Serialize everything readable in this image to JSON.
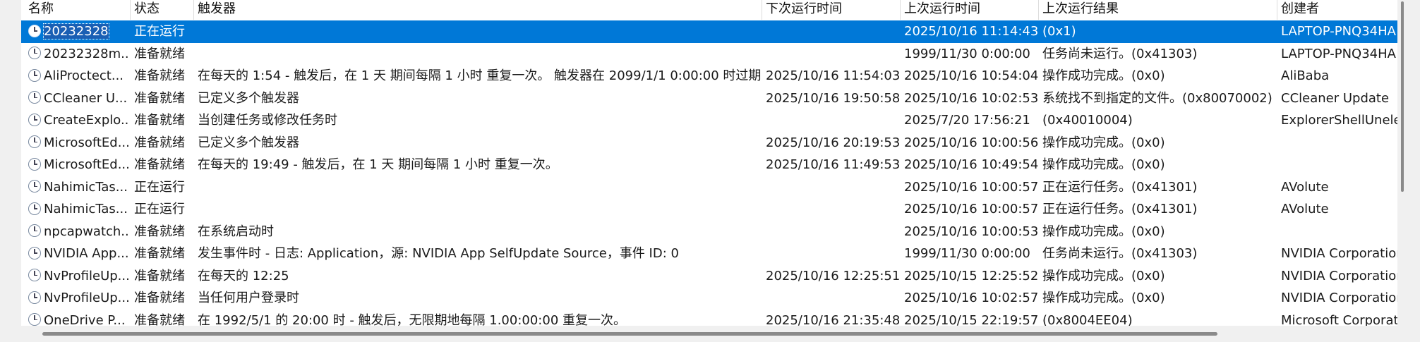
{
  "columns": {
    "name": "名称",
    "status": "状态",
    "trigger": "触发器",
    "next_run": "下次运行时间",
    "last_run": "上次运行时间",
    "last_result": "上次运行结果",
    "author": "创建者"
  },
  "rows": [
    {
      "name": "20232328",
      "status": "正在运行",
      "trigger": "",
      "next_run": "",
      "last_run": "2025/10/16 11:14:43",
      "last_result": "(0x1)",
      "author": "LAPTOP-PNQ34HA"
    },
    {
      "name": "20232328m...",
      "status": "准备就绪",
      "trigger": "",
      "next_run": "",
      "last_run": "1999/11/30 0:00:00",
      "last_result": "任务尚未运行。(0x41303)",
      "author": "LAPTOP-PNQ34HA"
    },
    {
      "name": "AliProctect...",
      "status": "准备就绪",
      "trigger": "在每天的 1:54 - 触发后，在 1 天 期间每隔 1 小时 重复一次。 触发器在 2099/1/1 0:00:00 时过期。",
      "next_run": "2025/10/16 11:54:03",
      "last_run": "2025/10/16 10:54:04",
      "last_result": "操作成功完成。(0x0)",
      "author": "AliBaba"
    },
    {
      "name": "CCleaner U...",
      "status": "准备就绪",
      "trigger": "已定义多个触发器",
      "next_run": "2025/10/16 19:50:58",
      "last_run": "2025/10/16 10:02:53",
      "last_result": "系统找不到指定的文件。(0x80070002)",
      "author": "CCleaner Update"
    },
    {
      "name": "CreateExplo...",
      "status": "准备就绪",
      "trigger": "当创建任务或修改任务时",
      "next_run": "",
      "last_run": "2025/7/20 17:56:21",
      "last_result": "(0x40010004)",
      "author": "ExplorerShellUnelev"
    },
    {
      "name": "MicrosoftEd...",
      "status": "准备就绪",
      "trigger": "已定义多个触发器",
      "next_run": "2025/10/16 20:19:53",
      "last_run": "2025/10/16 10:00:56",
      "last_result": "操作成功完成。(0x0)",
      "author": ""
    },
    {
      "name": "MicrosoftEd...",
      "status": "准备就绪",
      "trigger": "在每天的 19:49 - 触发后，在 1 天 期间每隔 1 小时 重复一次。",
      "next_run": "2025/10/16 11:49:53",
      "last_run": "2025/10/16 10:49:54",
      "last_result": "操作成功完成。(0x0)",
      "author": ""
    },
    {
      "name": "NahimicTas...",
      "status": "正在运行",
      "trigger": "",
      "next_run": "",
      "last_run": "2025/10/16 10:00:57",
      "last_result": "正在运行任务。(0x41301)",
      "author": "AVolute"
    },
    {
      "name": "NahimicTas...",
      "status": "正在运行",
      "trigger": "",
      "next_run": "",
      "last_run": "2025/10/16 10:00:57",
      "last_result": "正在运行任务。(0x41301)",
      "author": "AVolute"
    },
    {
      "name": "npcapwatch...",
      "status": "准备就绪",
      "trigger": "在系统启动时",
      "next_run": "",
      "last_run": "2025/10/16 10:00:53",
      "last_result": "操作成功完成。(0x0)",
      "author": ""
    },
    {
      "name": "NVIDIA App...",
      "status": "准备就绪",
      "trigger": "发生事件时 - 日志: Application，源: NVIDIA App SelfUpdate Source，事件 ID: 0",
      "next_run": "",
      "last_run": "1999/11/30 0:00:00",
      "last_result": "任务尚未运行。(0x41303)",
      "author": "NVIDIA Corporation"
    },
    {
      "name": "NvProfileUp...",
      "status": "准备就绪",
      "trigger": "在每天的 12:25",
      "next_run": "2025/10/16 12:25:51",
      "last_run": "2025/10/15 12:25:52",
      "last_result": "操作成功完成。(0x0)",
      "author": "NVIDIA Corporation"
    },
    {
      "name": "NvProfileUp...",
      "status": "准备就绪",
      "trigger": "当任何用户登录时",
      "next_run": "",
      "last_run": "2025/10/16 10:02:57",
      "last_result": "操作成功完成。(0x0)",
      "author": "NVIDIA Corporation"
    },
    {
      "name": "OneDrive P...",
      "status": "准备就绪",
      "trigger": "在 1992/5/1 的 20:00 时 - 触发后，无限期地每隔 1.00:00:00 重复一次。",
      "next_run": "2025/10/16 21:35:48",
      "last_run": "2025/10/15 22:19:57",
      "last_result": "(0x8004EE04)",
      "author": "Microsoft Corporatio"
    }
  ],
  "selected_row_index": 0,
  "colors": {
    "selection": "#0078d7"
  }
}
